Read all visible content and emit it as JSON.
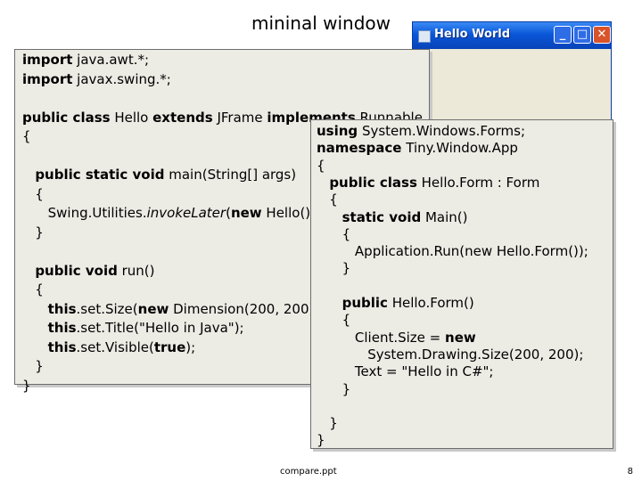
{
  "slide": {
    "title": "mininal window",
    "footer": "compare.ppt",
    "page_number": "8"
  },
  "window": {
    "title": "Hello World",
    "controls": {
      "minimize": "_",
      "maximize": "□",
      "close": "✕"
    },
    "icon": "app-icon"
  },
  "java_code": [
    [
      {
        "t": "import",
        "k": true
      },
      {
        "t": " java.awt.*;"
      }
    ],
    [
      {
        "t": "import",
        "k": true
      },
      {
        "t": " javax.swing.*;"
      }
    ],
    [],
    [
      {
        "t": "public class",
        "k": true
      },
      {
        "t": " Hello "
      },
      {
        "t": "extends",
        "k": true
      },
      {
        "t": " JFrame "
      },
      {
        "t": "implements",
        "k": true
      },
      {
        "t": " Runnable"
      }
    ],
    [
      {
        "t": "{"
      }
    ],
    [],
    [
      {
        "t": "   "
      },
      {
        "t": "public static void",
        "k": true
      },
      {
        "t": " main(String[] args)"
      }
    ],
    [
      {
        "t": "   {"
      }
    ],
    [
      {
        "t": "      Swing.Utilities."
      },
      {
        "t": "invokeLater",
        "i": true
      },
      {
        "t": "("
      },
      {
        "t": "new",
        "k": true
      },
      {
        "t": " Hello());"
      }
    ],
    [
      {
        "t": "   }"
      }
    ],
    [],
    [
      {
        "t": "   "
      },
      {
        "t": "public void",
        "k": true
      },
      {
        "t": " run()"
      }
    ],
    [
      {
        "t": "   {"
      }
    ],
    [
      {
        "t": "      "
      },
      {
        "t": "this",
        "k": true
      },
      {
        "t": ".set.Size("
      },
      {
        "t": "new",
        "k": true
      },
      {
        "t": " Dimension(200, 200));"
      }
    ],
    [
      {
        "t": "      "
      },
      {
        "t": "this",
        "k": true
      },
      {
        "t": ".set.Title(\"Hello in Java\");"
      }
    ],
    [
      {
        "t": "      "
      },
      {
        "t": "this",
        "k": true
      },
      {
        "t": ".set.Visible("
      },
      {
        "t": "true",
        "k": true
      },
      {
        "t": ");"
      }
    ],
    [
      {
        "t": "   }"
      }
    ],
    [
      {
        "t": "}"
      }
    ]
  ],
  "csharp_code": [
    [
      {
        "t": "using",
        "k": true
      },
      {
        "t": " System.Windows.Forms;"
      }
    ],
    [
      {
        "t": "namespace",
        "k": true
      },
      {
        "t": " Tiny.Window.App"
      }
    ],
    [
      {
        "t": "{"
      }
    ],
    [
      {
        "t": "   "
      },
      {
        "t": "public class",
        "k": true
      },
      {
        "t": " Hello.Form : Form"
      }
    ],
    [
      {
        "t": "   {"
      }
    ],
    [
      {
        "t": "      "
      },
      {
        "t": "static void",
        "k": true
      },
      {
        "t": " Main()"
      }
    ],
    [
      {
        "t": "      {"
      }
    ],
    [
      {
        "t": "         Application.Run(new Hello.Form());"
      }
    ],
    [
      {
        "t": "      }"
      }
    ],
    [],
    [
      {
        "t": "      "
      },
      {
        "t": "public",
        "k": true
      },
      {
        "t": " Hello.Form()"
      }
    ],
    [
      {
        "t": "      {"
      }
    ],
    [
      {
        "t": "         Client.Size = "
      },
      {
        "t": "new",
        "k": true
      }
    ],
    [
      {
        "t": "            System.Drawing.Size(200, 200);"
      }
    ],
    [
      {
        "t": "         Text = \"Hello in C#\";"
      }
    ],
    [
      {
        "t": "      }"
      }
    ],
    [],
    [
      {
        "t": "   }"
      }
    ],
    [
      {
        "t": "}"
      }
    ]
  ]
}
